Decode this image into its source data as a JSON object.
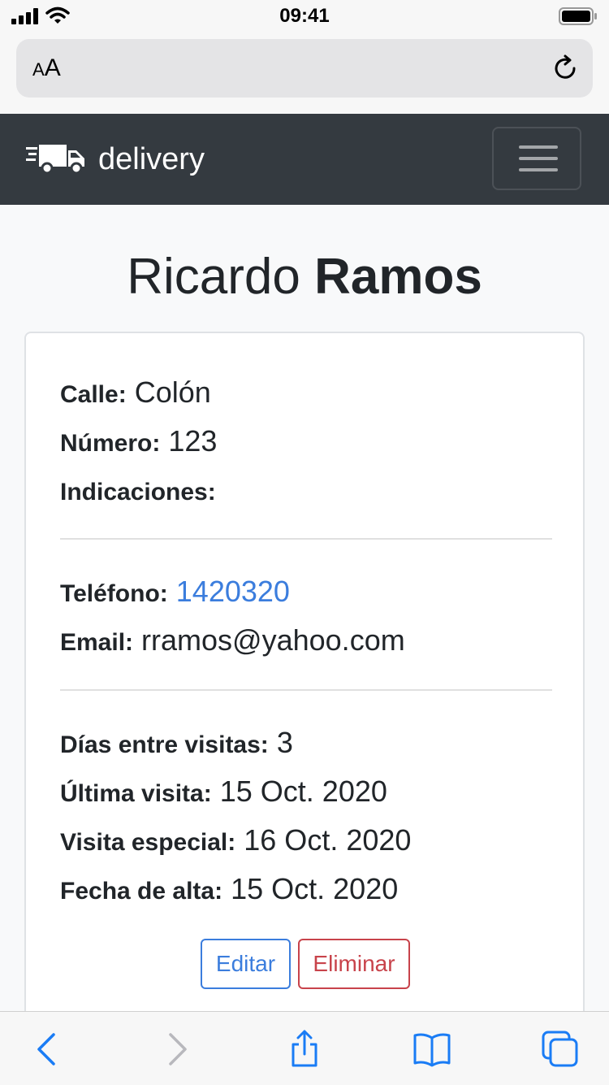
{
  "status_bar": {
    "time": "09:41"
  },
  "safari": {
    "aa_small": "A",
    "aa_large": "A",
    "icons": {
      "reload": "reload-icon",
      "back": "back-chevron-icon",
      "forward": "forward-chevron-icon",
      "share": "share-icon",
      "bookmarks": "bookmarks-icon",
      "tabs": "tabs-icon"
    }
  },
  "navbar": {
    "brand": "delivery",
    "logo_icon": "truck-icon",
    "menu_icon": "hamburger-menu-icon"
  },
  "customer": {
    "first_name": "Ricardo",
    "last_name": "Ramos"
  },
  "details": {
    "address": [
      {
        "label": "Calle:",
        "value": "Colón"
      },
      {
        "label": "Número:",
        "value": "123"
      },
      {
        "label": "Indicaciones:",
        "value": ""
      }
    ],
    "contact": [
      {
        "label": "Teléfono:",
        "value": "1420320"
      },
      {
        "label": "Email:",
        "value": "rramos@yahoo.com"
      }
    ],
    "visits": [
      {
        "label": "Días entre visitas:",
        "value": "3"
      },
      {
        "label": "Última visita:",
        "value": "15 Oct. 2020"
      },
      {
        "label": "Visita especial:",
        "value": "16 Oct. 2020"
      },
      {
        "label": "Fecha de alta:",
        "value": "15 Oct. 2020"
      }
    ]
  },
  "actions": {
    "edit": "Editar",
    "delete": "Eliminar"
  },
  "colors": {
    "navbar": "#343a40",
    "link": "#3b7ddd",
    "danger": "#c8434b",
    "ios_blue": "#1a7cf5"
  }
}
